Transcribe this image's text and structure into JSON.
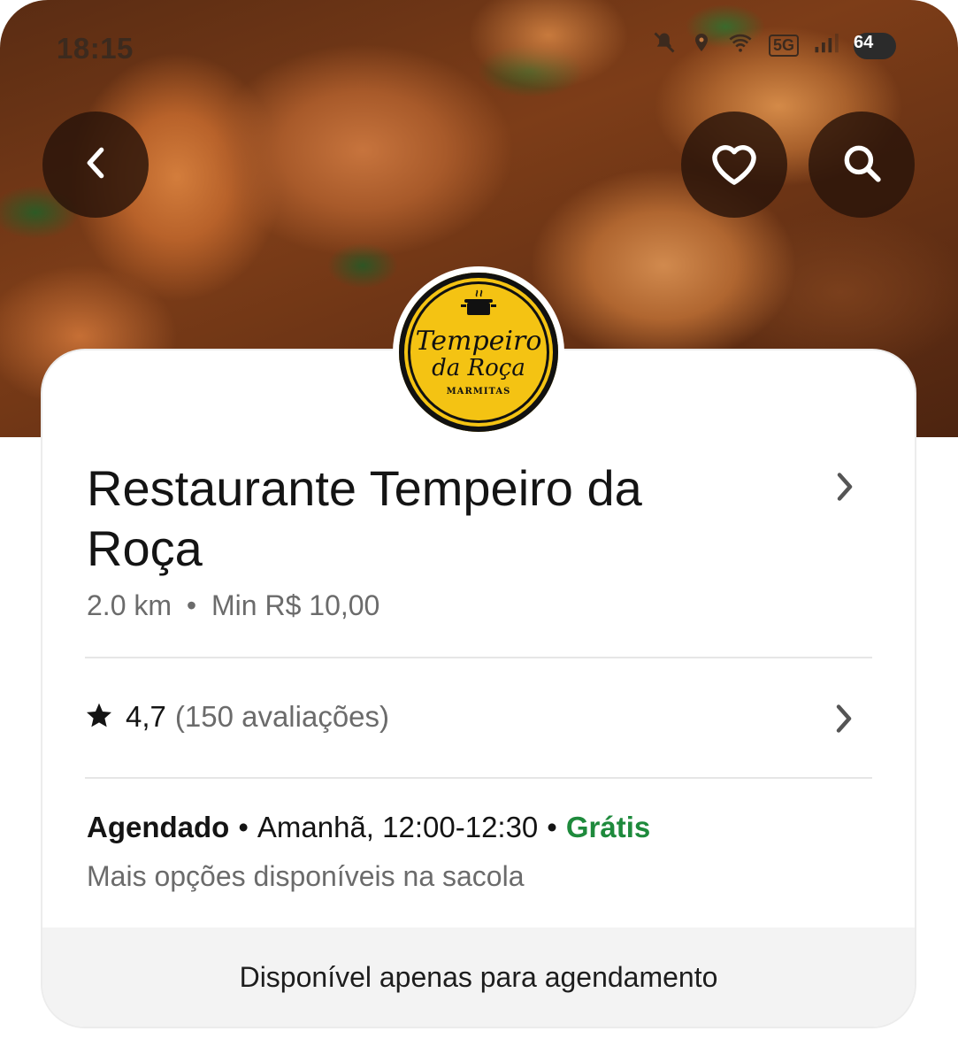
{
  "status_bar": {
    "time": "18:15",
    "network": "5G",
    "battery": "64"
  },
  "header": {
    "back_icon": "chevron-left-icon",
    "favorite_icon": "heart-icon",
    "search_icon": "search-icon"
  },
  "logo": {
    "line1": "Tempeiro",
    "line2": "da Roça",
    "tagline": "MARMITAS"
  },
  "restaurant": {
    "name": "Restaurante Tempeiro da Roça",
    "distance": "2.0 km",
    "separator": "•",
    "minimum": "Min R$ 10,00",
    "rating": "4,7",
    "reviews": "(150 avaliações)"
  },
  "schedule": {
    "mode": "Agendado",
    "window": "Amanhã, 12:00-12:30",
    "fee": "Grátis",
    "more_options": "Mais opções disponíveis na sacola"
  },
  "footer": {
    "notice": "Disponível apenas para agendamento"
  },
  "colors": {
    "accent_green": "#1e8a3c",
    "logo_yellow": "#f4c313",
    "button_dark": "#28140a"
  }
}
